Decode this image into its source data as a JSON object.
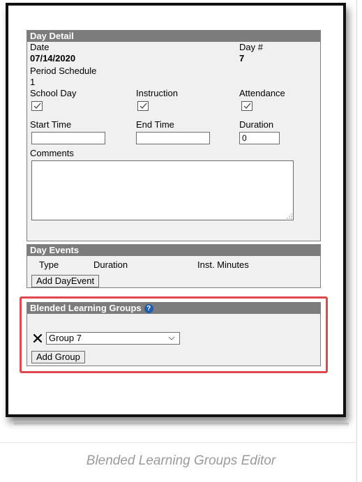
{
  "day_detail": {
    "title": "Day Detail",
    "date_label": "Date",
    "date_value": "07/14/2020",
    "day_num_label": "Day #",
    "day_num_value": "7",
    "period_schedule_label": "Period Schedule",
    "period_schedule_value": "1",
    "school_day_label": "School Day",
    "instruction_label": "Instruction",
    "attendance_label": "Attendance",
    "start_time_label": "Start Time",
    "end_time_label": "End Time",
    "duration_label": "Duration",
    "start_time_value": "",
    "end_time_value": "",
    "duration_value": "0",
    "comments_label": "Comments",
    "comments_value": "",
    "school_day_checked": true,
    "instruction_checked": true,
    "attendance_checked": true
  },
  "day_events": {
    "title": "Day Events",
    "col_type": "Type",
    "col_duration": "Duration",
    "col_inst_minutes": "Inst. Minutes",
    "add_button": "Add DayEvent"
  },
  "blended": {
    "title": "Blended Learning Groups",
    "help_icon": "?",
    "group_selected": "Group 7",
    "add_button": "Add Group",
    "remove_icon": "x-icon"
  },
  "caption": "Blended Learning Groups Editor",
  "colors": {
    "panel_header": "#7c7c7c",
    "highlight": "#e0484b",
    "help": "#1f5fb0"
  }
}
